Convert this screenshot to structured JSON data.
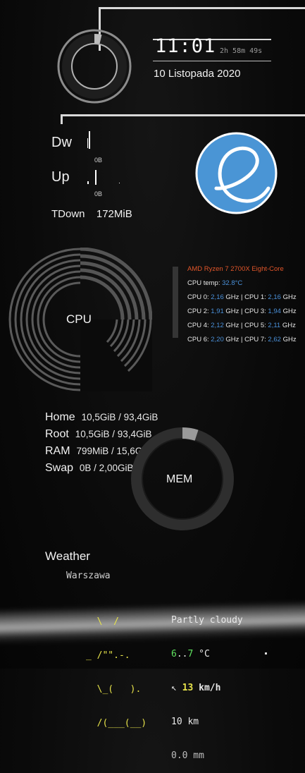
{
  "clock": {
    "time": "11:01",
    "uptime": "2h 58m 49s",
    "date": "10 Listopada 2020"
  },
  "network": {
    "down_label": "Dw",
    "down_value": "0B",
    "up_label": "Up",
    "up_value": "0B",
    "total_down_label": "TDown",
    "total_down_value": "172MiB"
  },
  "logo": {
    "icon": "elementary-os-logo"
  },
  "cpu": {
    "label": "CPU",
    "model": "AMD Ryzen 7 2700X Eight-Core",
    "temp_label": "CPU temp:",
    "temp_value": "32.8°C",
    "cores": [
      {
        "a_label": "CPU 0:",
        "a_val": "2,16",
        "b_label": "CPU 1:",
        "b_val": "2,16"
      },
      {
        "a_label": "CPU 2:",
        "a_val": "1,91",
        "b_label": "CPU 3:",
        "b_val": "1,94"
      },
      {
        "a_label": "CPU 4:",
        "a_val": "2,12",
        "b_label": "CPU 5:",
        "b_val": "2,11"
      },
      {
        "a_label": "CPU 6:",
        "a_val": "2,20",
        "b_label": "CPU 7:",
        "b_val": "2,62"
      }
    ],
    "unit": "GHz",
    "sep": "|"
  },
  "disks": [
    {
      "label": "Home",
      "value": "10,5GiB / 93,4GiB"
    },
    {
      "label": "Root",
      "value": "10,5GiB / 93,4GiB"
    },
    {
      "label": "RAM",
      "value": "799MiB / 15,6GiB"
    },
    {
      "label": "Swap",
      "value": "0B   / 2,00GiB"
    }
  ],
  "mem": {
    "label": "MEM",
    "usage_fraction": 0.05
  },
  "weather": {
    "title": "Weather",
    "city": "Warszawa",
    "art": [
      "  \\  /",
      "_ /\"\".-.",
      "  \\_(   ).",
      "  /(___(__)"
    ],
    "condition": "Partly cloudy",
    "temp_a": "6",
    "temp_sep": "..",
    "temp_b": "7",
    "temp_unit": " °C",
    "wind_arrow": "↖",
    "wind_value": "13",
    "wind_unit": "km/h",
    "visibility": "10 km",
    "precip": "0.0 mm"
  },
  "colors": {
    "accent_blue": "#4a90d9",
    "cpu_model": "#e2562a",
    "ring": "#9a9a9a"
  }
}
